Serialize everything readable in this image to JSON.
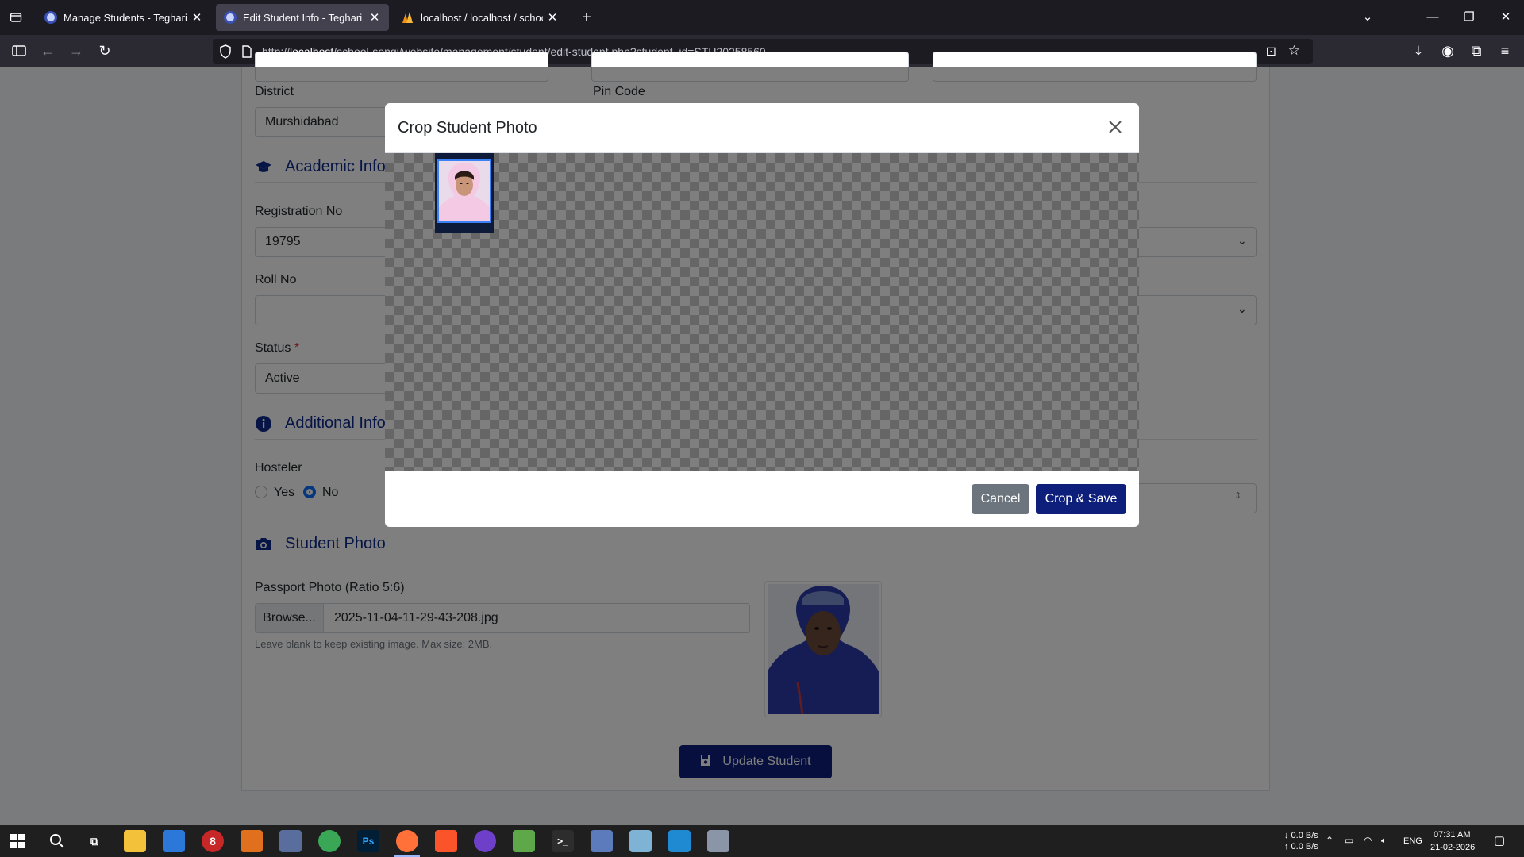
{
  "browser": {
    "tabs": [
      {
        "title": "Manage Students - Teghari Chh",
        "active": false
      },
      {
        "title": "Edit Student Info - Teghari Chh",
        "active": true
      },
      {
        "title": "localhost / localhost / school_sy",
        "active": false
      }
    ],
    "url_prefix": "http://",
    "url_host": "localhost",
    "url_path": "/school-songi/website/management/student/edit-student.php?student_id=STU20258560"
  },
  "form": {
    "district_label": "District",
    "district_value": "Murshidabad",
    "pincode_label": "Pin Code",
    "academic_title": "Academic Info",
    "registration_label": "Registration No",
    "registration_value": "19795",
    "roll_label": "Roll No",
    "roll_value": "",
    "status_label": "Status",
    "status_required": "*",
    "status_value": "Active",
    "additional_title": "Additional Info",
    "hosteler_label": "Hosteler",
    "hosteler_yes": "Yes",
    "hosteler_no": "No",
    "hosteler_selected": "No",
    "photo_title": "Student Photo",
    "passport_label": "Passport Photo (Ratio 5:6)",
    "browse_label": "Browse...",
    "file_name": "2025-11-04-11-29-43-208.jpg",
    "help_text": "Leave blank to keep existing image. Max size: 2MB.",
    "update_label": "Update Student"
  },
  "modal": {
    "title": "Crop Student Photo",
    "cancel_label": "Cancel",
    "crop_save_label": "Crop & Save"
  },
  "taskbar": {
    "net_down": "↓ 0.0 B/s",
    "net_up": "↑ 0.0 B/s",
    "lang": "ENG",
    "time": "07:31 AM",
    "date": "21-02-2026"
  },
  "colors": {
    "primary": "#0d1f7a",
    "section": "#0d2a8a",
    "secondary": "#6c757d"
  }
}
